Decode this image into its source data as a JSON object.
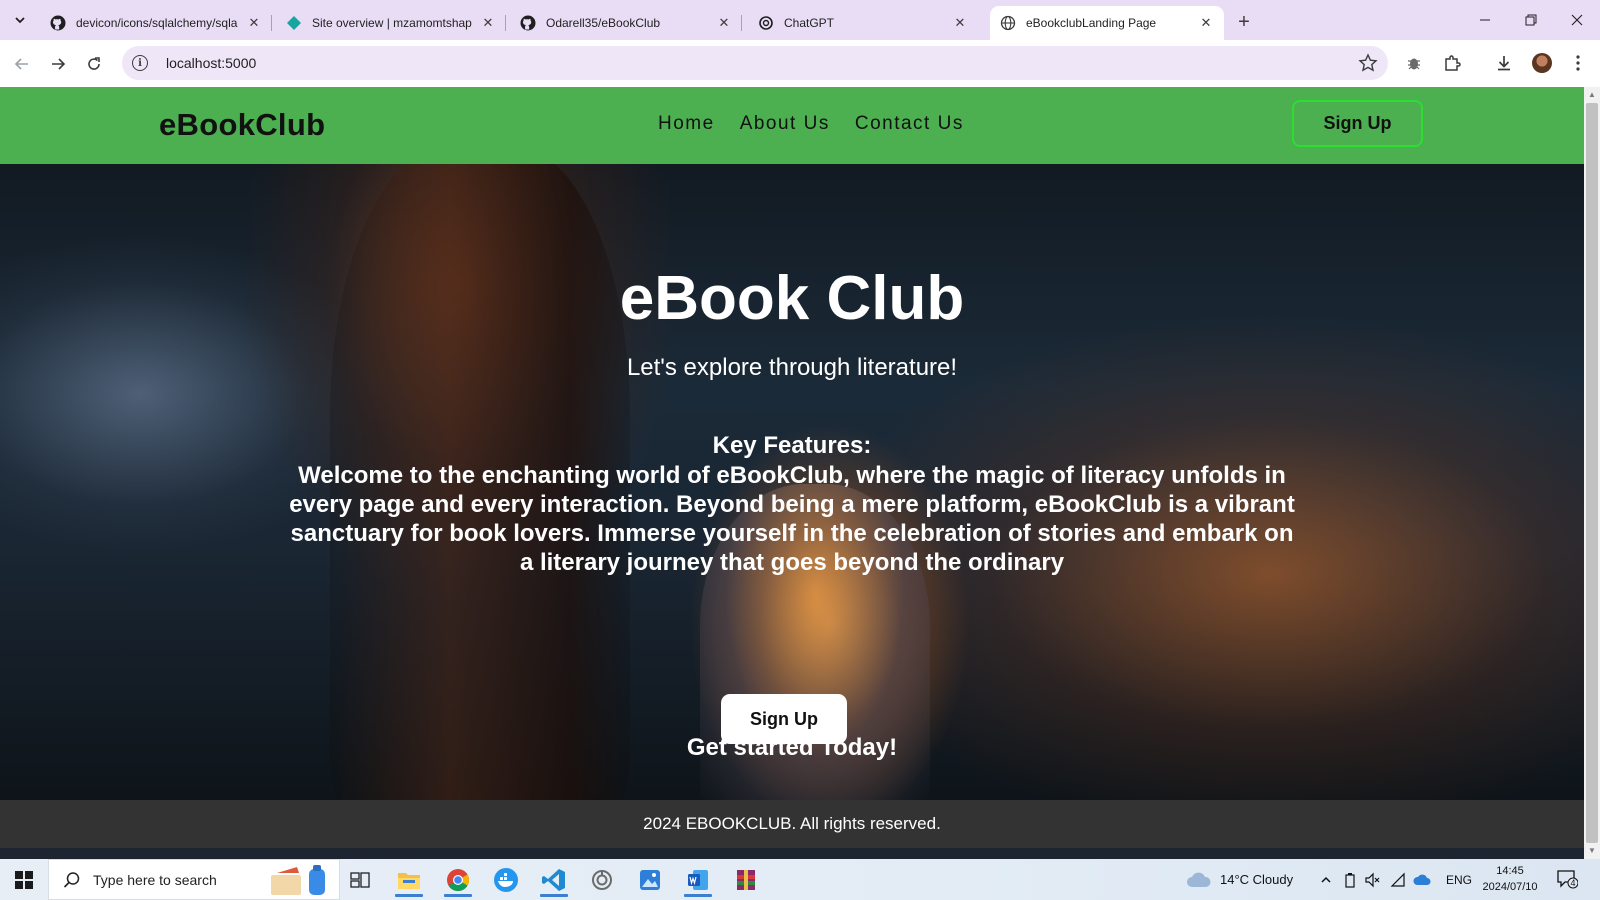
{
  "browser": {
    "tabs": [
      {
        "title": "devicon/icons/sqlalchemy/sqlalchemy",
        "favicon": "github-icon",
        "active": false
      },
      {
        "title": "Site overview | mzamomtshapri",
        "favicon": "netlify-icon",
        "active": false
      },
      {
        "title": "Odarell35/eBookClub",
        "favicon": "github-icon",
        "active": false
      },
      {
        "title": "ChatGPT",
        "favicon": "chatgpt-icon",
        "active": false
      },
      {
        "title": "eBookclubLanding Page",
        "favicon": "globe-icon",
        "active": true
      }
    ],
    "url": "localhost:5000"
  },
  "site": {
    "logo": "eBookClub",
    "nav": [
      "Home",
      "About Us",
      "Contact Us"
    ],
    "header_signup": "Sign Up",
    "hero": {
      "title": "eBook Club",
      "subtitle": "Let's explore through literature!",
      "features_title": "Key Features:",
      "features_text": "Welcome to the enchanting world of eBookClub, where the magic of literacy unfolds in every page and every interaction. Beyond being a mere platform, eBookClub is a vibrant sanctuary for book lovers. Immerse yourself in the celebration of stories and embark on a literary journey that goes beyond the ordinary",
      "signup_button": "Sign Up",
      "cta": "Get started Today!"
    },
    "footer": "2024 EBOOKCLUB. All rights reserved.",
    "colors": {
      "header_bg": "#4caf50",
      "footer_bg": "#333333",
      "button_border": "#2dde32"
    }
  },
  "taskbar": {
    "search_placeholder": "Type here to search",
    "apps": [
      "widgets-icon",
      "task-view-icon",
      "file-explorer-icon",
      "chrome-icon",
      "docker-icon",
      "vscode-icon",
      "app-icon",
      "photos-icon",
      "word-icon",
      "winrar-icon"
    ],
    "weather": "14°C  Cloudy",
    "language": "ENG",
    "time": "14:45",
    "date": "2024/07/10",
    "notifications": "4"
  }
}
